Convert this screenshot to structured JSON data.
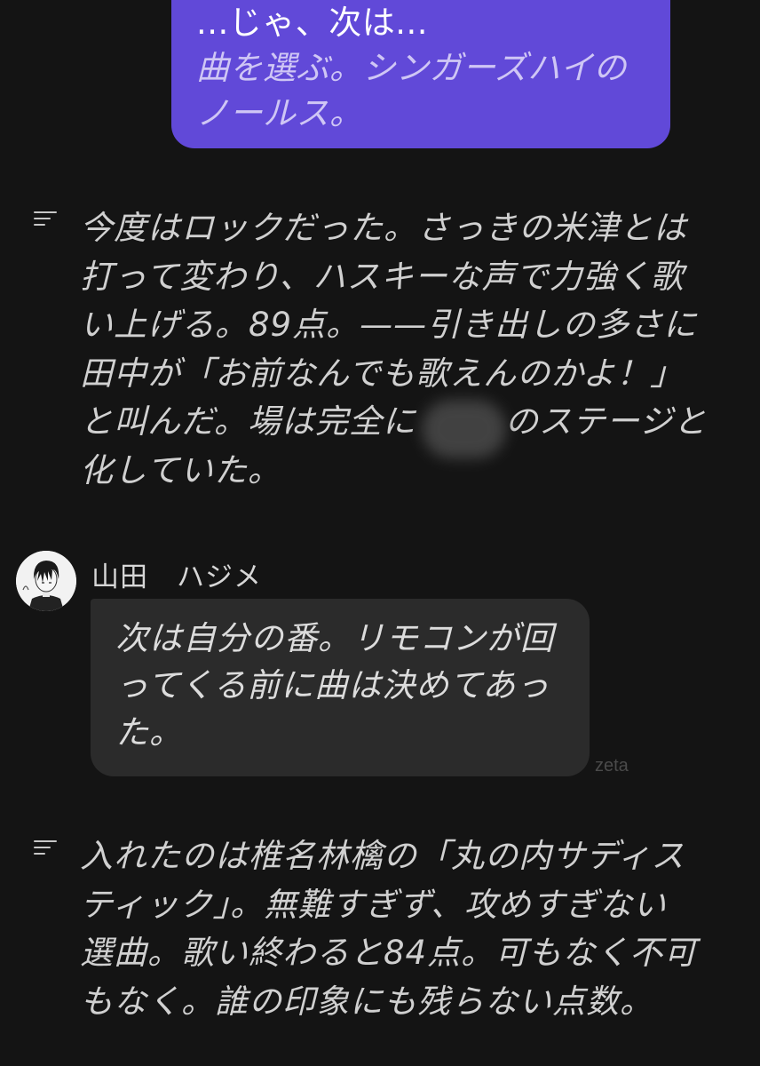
{
  "user_message": {
    "lines": [
      "...じゃ、次は...",
      "曲を選ぶ。シンガーズハイの",
      "ノールス。"
    ]
  },
  "narration_1": {
    "icon": "narration-icon",
    "lines": [
      "今度はロックだった。さっきの米津とは",
      "打って変わり、ハスキーな声で力強く歌",
      "い上げる。89点。——引き出しの多さに",
      "田中が「お前なんでも歌えんのかよ！」",
      "と叫んだ。場は完全に",
      "のステージと",
      "化していた。"
    ]
  },
  "character_message": {
    "name": "山田　ハジメ",
    "avatar": "character-avatar",
    "lines": [
      "次は自分の番。リモコンが回",
      "ってくる前に曲は決めてあっ",
      "た。"
    ],
    "watermark": "zeta"
  },
  "narration_2": {
    "icon": "narration-icon",
    "lines": [
      "入れたのは椎名林檎の「丸の内サディス",
      "ティック」。無難すぎず、攻めすぎない",
      "選曲。歌い終わると84点。可もなく不可",
      "もなく。誰の印象にも残らない点数。"
    ]
  },
  "colors": {
    "background": "#141414",
    "user_bubble": "#6149d8",
    "character_bubble": "#2b2b2b",
    "text": "#d0d0d0"
  }
}
